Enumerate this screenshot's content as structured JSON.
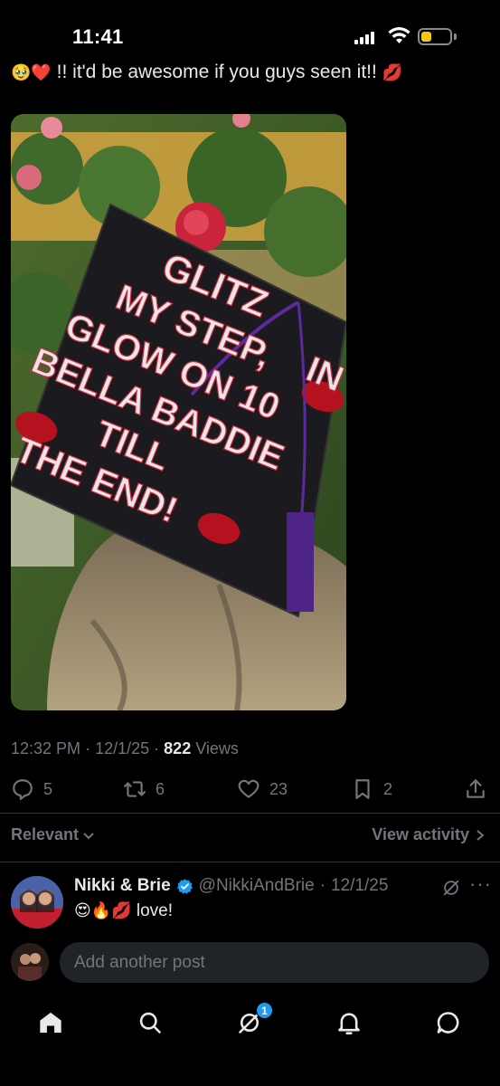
{
  "status_bar": {
    "time": "11:41",
    "battery_level": 0.35,
    "battery_color": "#f5c518"
  },
  "post": {
    "text_emojis": "🥹❤️",
    "text": " !! it'd be awesome if you guys seen it!! ",
    "text_trailing_emoji": "💋",
    "media": {
      "alt": "Decorated graduation cap",
      "cap_lines": [
        "GLITZ",
        "IN",
        "MY STEP,",
        "GLOW ON 10",
        "BELLA BADDIE",
        "TILL",
        "THE END!"
      ]
    },
    "time": "12:32 PM",
    "separator": "·",
    "date": "12/1/25",
    "views_count": "822",
    "views_label": "Views",
    "stats": {
      "replies": "5",
      "reposts": "6",
      "likes": "23",
      "bookmarks": "2"
    }
  },
  "replies_filter": {
    "label": "Relevant",
    "view_activity": "View activity"
  },
  "reply": {
    "name": "Nikki & Brie",
    "handle": "@NikkiAndBrie",
    "date_sep": "·",
    "date": "12/1/25",
    "emojis": "😍🔥💋",
    "text": " love!"
  },
  "compose": {
    "placeholder": "Add another post"
  },
  "tabbar": {
    "grok_badge": "1"
  },
  "colors": {
    "accent": "#1d9bf0",
    "muted": "#71767b",
    "text": "#e7e9ea",
    "background": "#000000"
  }
}
